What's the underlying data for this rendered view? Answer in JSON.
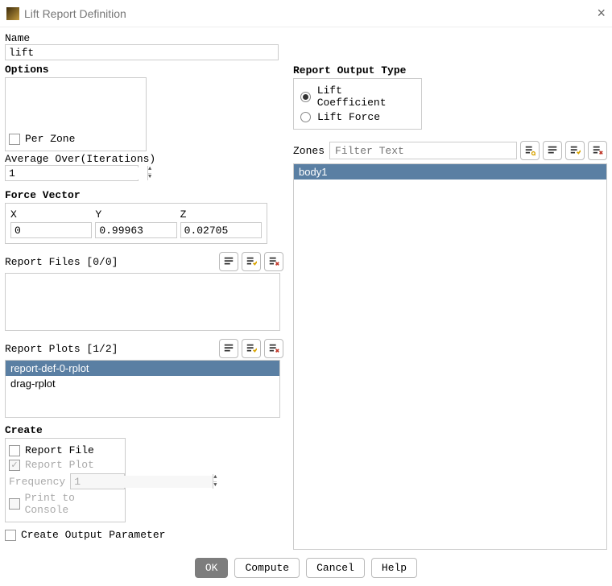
{
  "window": {
    "title": "Lift Report Definition"
  },
  "name": {
    "label": "Name",
    "value": "lift"
  },
  "options": {
    "title": "Options",
    "per_zone": "Per Zone",
    "avg_over_label": "Average Over(Iterations)",
    "avg_over_value": "1"
  },
  "force_vector": {
    "title": "Force Vector",
    "x_label": "X",
    "y_label": "Y",
    "z_label": "Z",
    "x": "0",
    "y": "0.99963",
    "z": "0.02705"
  },
  "report_files": {
    "label": "Report Files [0/0]"
  },
  "report_plots": {
    "label": "Report Plots [1/2]",
    "items": [
      "report-def-0-rplot",
      "drag-rplot"
    ],
    "selected_index": 0
  },
  "create": {
    "title": "Create",
    "report_file": "Report File",
    "report_plot": "Report Plot",
    "frequency_label": "Frequency",
    "frequency_value": "1",
    "print_console": "Print to Console"
  },
  "create_output_param": "Create Output Parameter",
  "output_type": {
    "title": "Report Output Type",
    "opt1": "Lift Coefficient",
    "opt2": "Lift Force",
    "selected": 0
  },
  "zones": {
    "label": "Zones",
    "placeholder": "Filter Text",
    "items": [
      "body1"
    ],
    "selected_index": 0
  },
  "footer": {
    "ok": "OK",
    "compute": "Compute",
    "cancel": "Cancel",
    "help": "Help"
  }
}
